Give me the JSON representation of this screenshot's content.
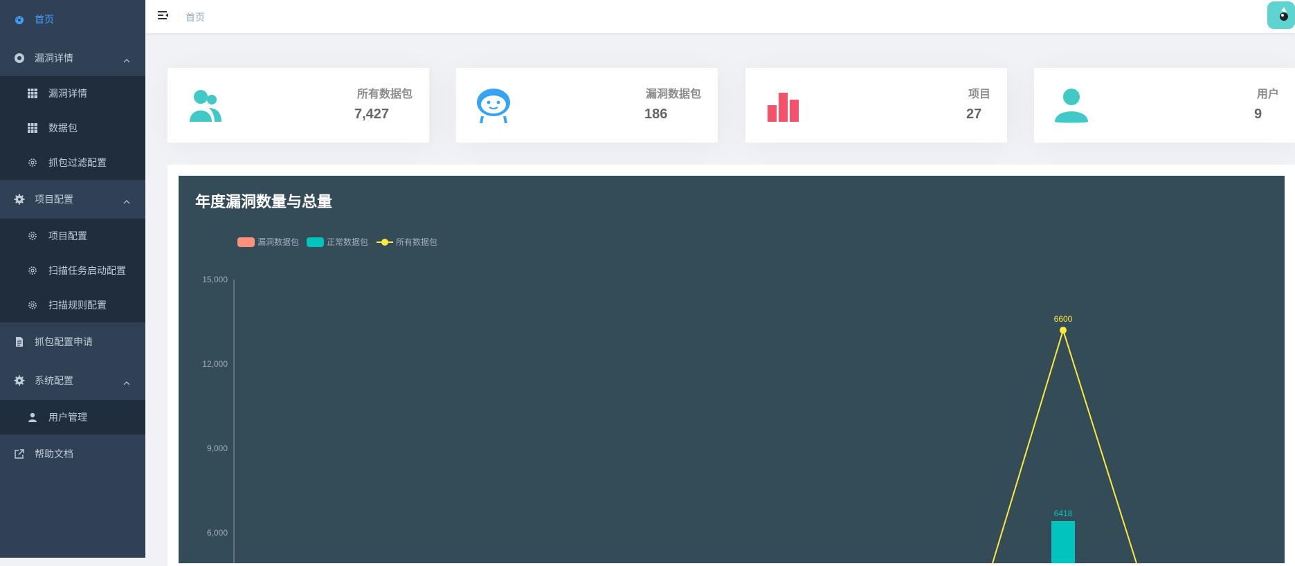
{
  "sidebar": {
    "home": "首页",
    "vuln_group": "漏洞详情",
    "vuln_children": [
      "漏洞详情",
      "数据包",
      "抓包过滤配置"
    ],
    "project_group": "项目配置",
    "project_children": [
      "项目配置",
      "扫描任务启动配置",
      "扫描规则配置"
    ],
    "capture_apply": "抓包配置申请",
    "system_group": "系统配置",
    "system_children": [
      "用户管理"
    ],
    "help": "帮助文档"
  },
  "navbar": {
    "breadcrumb": "首页"
  },
  "cards": [
    {
      "label": "所有数据包",
      "value": "7,427",
      "icon": "peoples-icon",
      "color": "#40c9c6"
    },
    {
      "label": "漏洞数据包",
      "value": "186",
      "icon": "robot-face-icon",
      "color": "#36a3f7"
    },
    {
      "label": "项目",
      "value": "27",
      "icon": "bar-chart-icon",
      "color": "#f4516c"
    },
    {
      "label": "用户",
      "value": "9",
      "icon": "user-icon",
      "color": "#40c9c6"
    }
  ],
  "chart": {
    "title": "年度漏洞数量与总量",
    "legend": [
      "漏洞数据包",
      "正常数据包",
      "所有数据包"
    ],
    "colors": {
      "vuln": "#ff917c",
      "normal": "#00c4bd",
      "all": "#ffeb3b"
    }
  },
  "chart_data": {
    "type": "bar",
    "title": "年度漏洞数量与总量",
    "ylim": [
      0,
      15000
    ],
    "yticks": [
      "15,000",
      "12,000",
      "9,000",
      "6,000"
    ],
    "series": [
      {
        "name": "漏洞数据包",
        "type": "bar"
      },
      {
        "name": "正常数据包",
        "type": "bar",
        "visible_points": [
          {
            "value": 6418,
            "label": "6418"
          }
        ]
      },
      {
        "name": "所有数据包",
        "type": "line",
        "visible_points": [
          {
            "value": 6600,
            "label": "6600"
          }
        ]
      }
    ],
    "grid": false,
    "legend_position": "top-left"
  }
}
